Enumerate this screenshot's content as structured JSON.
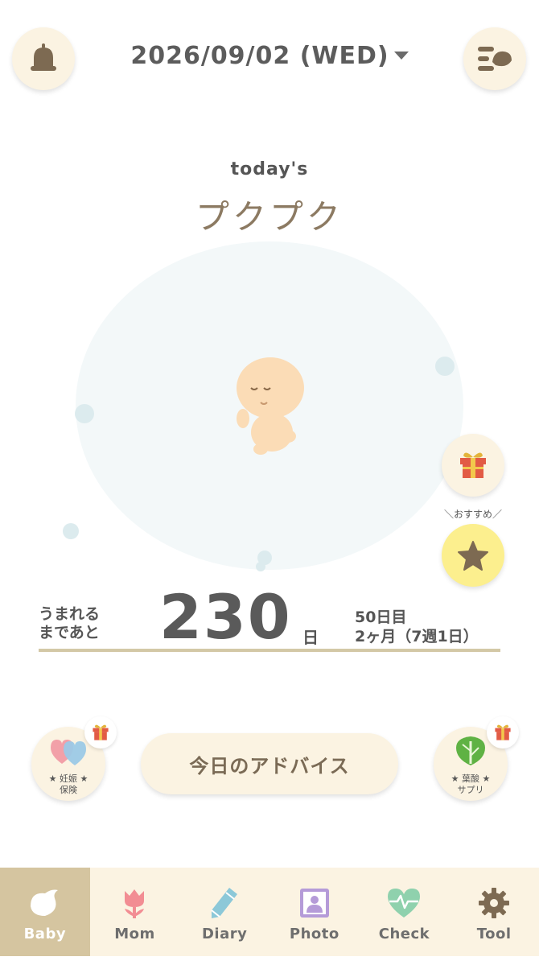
{
  "header": {
    "date": "2026/09/02 (WED)"
  },
  "today": {
    "label": "today's",
    "word": "プクプク"
  },
  "recommend": {
    "label": "＼おすすめ／"
  },
  "countdown": {
    "label_line1": "うまれる",
    "label_line2": "まであと",
    "days_remaining": "230",
    "unit": "日",
    "day_number": "50日目",
    "month_week": "2ヶ月（7週1日）"
  },
  "shortcuts": {
    "insurance_line1": "★ 妊娠 ★",
    "insurance_line2": "保険",
    "supplement_line1": "★ 葉酸 ★",
    "supplement_line2": "サプリ"
  },
  "advice_button": "今日のアドバイス",
  "tabs": [
    {
      "label": "Baby",
      "icon": "bird-icon",
      "active": true
    },
    {
      "label": "Mom",
      "icon": "tulip-icon",
      "active": false
    },
    {
      "label": "Diary",
      "icon": "pencil-icon",
      "active": false
    },
    {
      "label": "Photo",
      "icon": "photo-icon",
      "active": false
    },
    {
      "label": "Check",
      "icon": "heart-pulse-icon",
      "active": false
    },
    {
      "label": "Tool",
      "icon": "gear-icon",
      "active": false
    }
  ],
  "colors": {
    "accent": "#d5c5a0",
    "button_bg": "#fbf3e2",
    "recommend_bg": "#fcef8e",
    "word_color": "#8c7a62"
  }
}
